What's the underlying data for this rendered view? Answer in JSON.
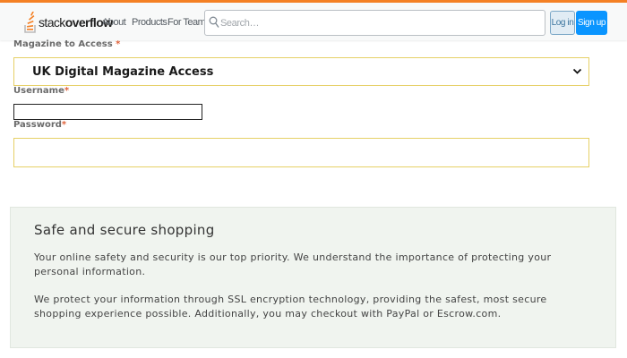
{
  "header": {
    "logo_light": "stack",
    "logo_bold": "overflow",
    "nav": [
      "About",
      "Products",
      "For Teams"
    ],
    "search_placeholder": "Search…",
    "login_label": "Log in",
    "signup_label": "Sign up",
    "colors": {
      "accent": "#f48024",
      "signup": "#0a95ff",
      "login_bg": "#e1ecf4"
    }
  },
  "form": {
    "magazine_label": "Magazine to Access ",
    "magazine_required": "*",
    "magazine_selected": "UK Digital Magazine Access",
    "username_label": "Username",
    "username_required": "*",
    "username_value": "",
    "password_label": "Password",
    "password_required": "*",
    "password_value": "",
    "colors": {
      "field_border": "#e6d066",
      "required": "#e0623a"
    }
  },
  "secure": {
    "title": "Safe and secure shopping",
    "paragraph1": "Your online safety and security is our top priority. We understand the importance of protecting your personal information.",
    "paragraph2": "We protect your information through SSL encryption technology, providing the safest, most secure shopping experience possible. Additionally, you may checkout with PayPal or Escrow.com.",
    "background": "#f0f4ef"
  },
  "icons": {
    "logo": "stackoverflow-logo-icon",
    "search": "search-icon",
    "dropdown": "chevron-down-icon"
  }
}
